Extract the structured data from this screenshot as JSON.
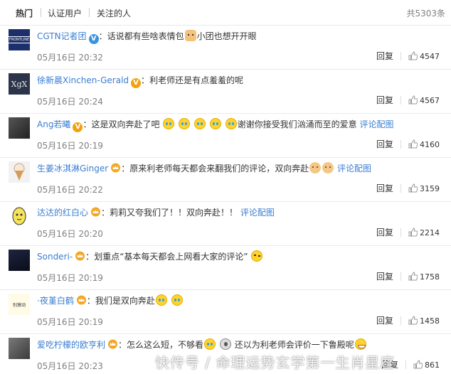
{
  "tabs": [
    {
      "label": "热门",
      "active": true
    },
    {
      "label": "认证用户",
      "active": false
    },
    {
      "label": "关注的人",
      "active": false
    }
  ],
  "total": "共5303条",
  "reply_label": "回复",
  "link_img_label": "评论配图",
  "comments": [
    {
      "user": "CGTN记者团",
      "badge": "blue-v",
      "parts": [
        "话说都有些啥表情包",
        "小团也想开开眼"
      ],
      "time": "05月16日 20:32",
      "likes": "4547",
      "avatar": "CGTN logo"
    },
    {
      "user": "徐新晨Xinchen-Gerald",
      "badge": "gold-v",
      "parts": [
        "利老师还是有点羞羞的呢"
      ],
      "time": "05月16日 20:24",
      "likes": "4567",
      "avatar": "XgX"
    },
    {
      "user": "Ang若曦",
      "badge": "gold-v",
      "parts": [
        "这是双向奔赴了吧",
        "谢谢你接受我们汹涌而至的爱意"
      ],
      "time": "05月16日 20:19",
      "likes": "4160",
      "avatar": "photo"
    },
    {
      "user": "生姜冰淇淋Ginger",
      "badge": "crown",
      "parts": [
        "原来利老师每天都会来翻我们的评论，双向奔赴"
      ],
      "time": "05月16日 20:22",
      "likes": "3159",
      "avatar": "ice cream"
    },
    {
      "user": "达达的红白心",
      "badge": "crown",
      "parts": [
        "莉莉又夸我们了！！双向奔赴！！"
      ],
      "time": "05月16日 20:20",
      "likes": "2214",
      "avatar": "cartoon"
    },
    {
      "user": "Sonderi-",
      "badge": "crown",
      "parts": [
        "划重点“基本每天都会上网看大家的评论”"
      ],
      "time": "05月16日 20:19",
      "likes": "1758",
      "avatar": "dark"
    },
    {
      "user": "·夜堇白鹤",
      "badge": "crown",
      "parts": [
        "我们是双向奔赴"
      ],
      "time": "05月16日 20:19",
      "likes": "1458",
      "avatar": "sticker"
    },
    {
      "user": "爱吃柠檬的欧亨利",
      "badge": "crown",
      "parts": [
        "怎么这么短，不够看",
        "还以为利老师会评价一下鲁殿呢"
      ],
      "time": "05月16日 20:23",
      "likes": "861",
      "avatar": "photo2"
    }
  ],
  "avatar_text": {
    "cgtn": "FRONTLINE",
    "xgx": "XgX",
    "sticker": "别激动"
  },
  "watermark": "快传号 / 命理运势玄学第一生肖星座",
  "colors": {
    "accent_orange": "#eb7350",
    "link_blue": "#3a7dd1",
    "vip_blue": "#3893e0",
    "vip_gold": "#f2a20d"
  }
}
